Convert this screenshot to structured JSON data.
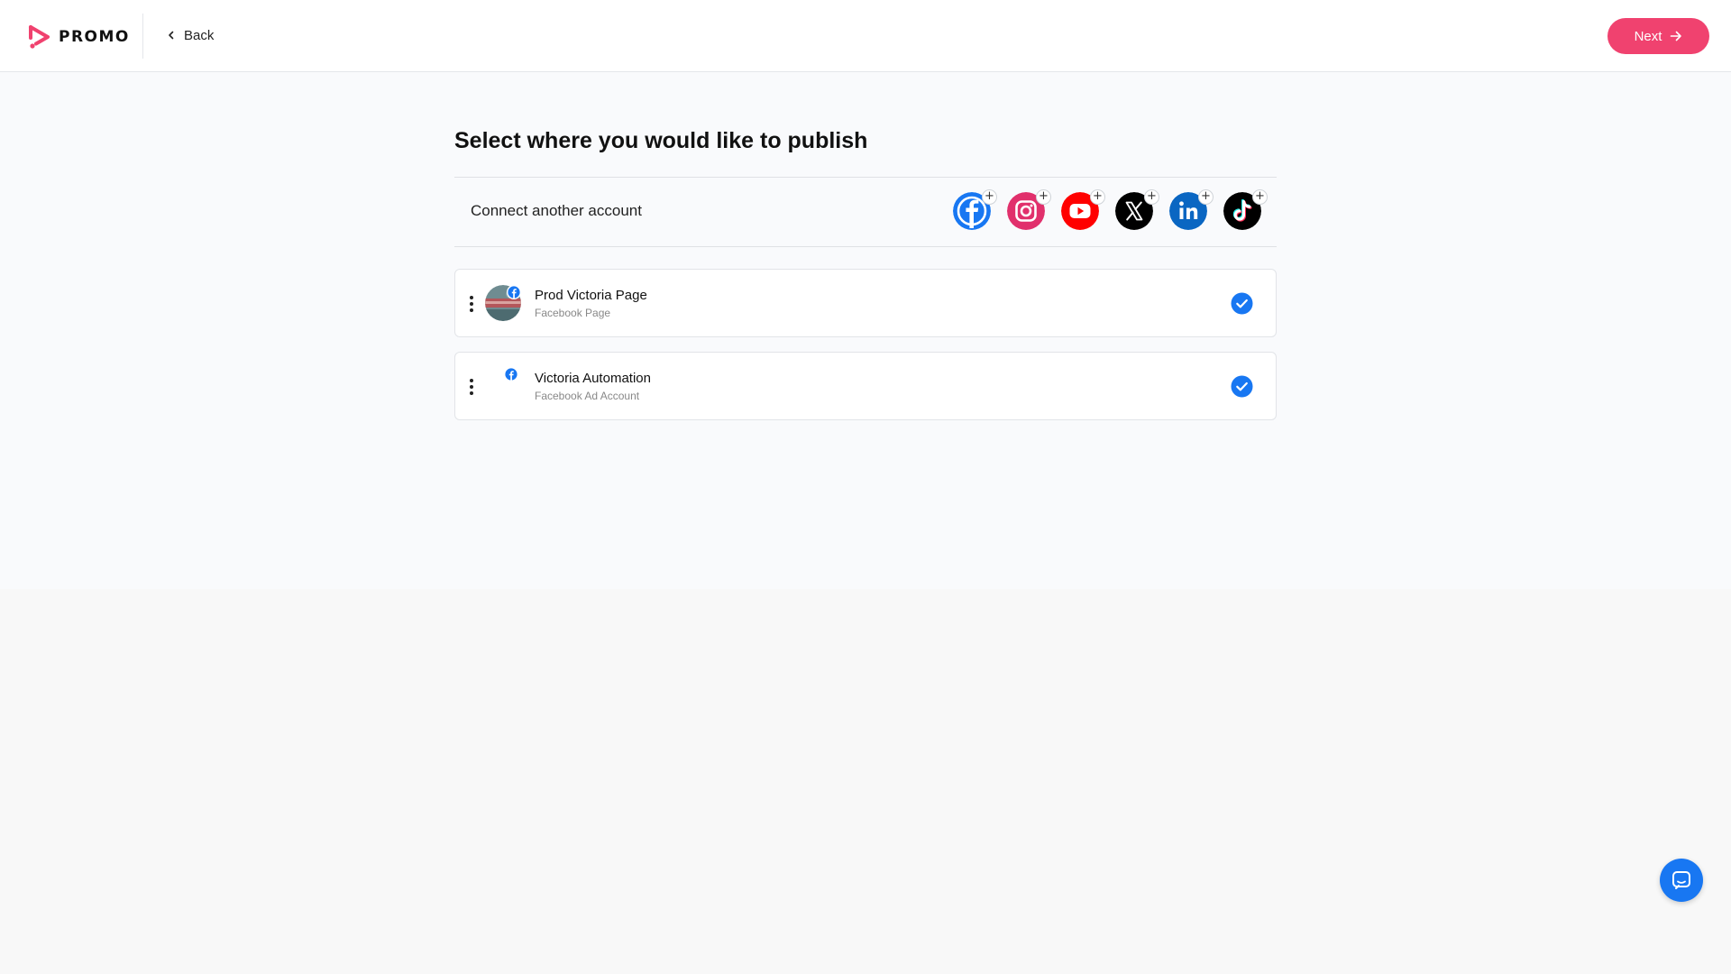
{
  "header": {
    "brand": "PROMO",
    "back_label": "Back",
    "next_label": "Next"
  },
  "main": {
    "heading": "Select where you would like to publish",
    "connect": {
      "label": "Connect another account",
      "providers": [
        {
          "name": "facebook-icon",
          "color": "#1877f2"
        },
        {
          "name": "instagram-icon",
          "color": "#e1306c"
        },
        {
          "name": "youtube-icon",
          "color": "#ff0000"
        },
        {
          "name": "x-icon",
          "color": "#000000"
        },
        {
          "name": "linkedin-icon",
          "color": "#0a66c2"
        },
        {
          "name": "tiktok-icon",
          "color": "#000000"
        }
      ]
    },
    "accounts": [
      {
        "name": "Prod Victoria Page",
        "type": "Facebook Page",
        "selected": true,
        "has_avatar": true
      },
      {
        "name": "Victoria Automation",
        "type": "Facebook Ad Account",
        "selected": true,
        "has_avatar": false
      }
    ]
  },
  "colors": {
    "accent": "#f0426f",
    "check": "#1877f2",
    "chat": "#1877f2"
  }
}
